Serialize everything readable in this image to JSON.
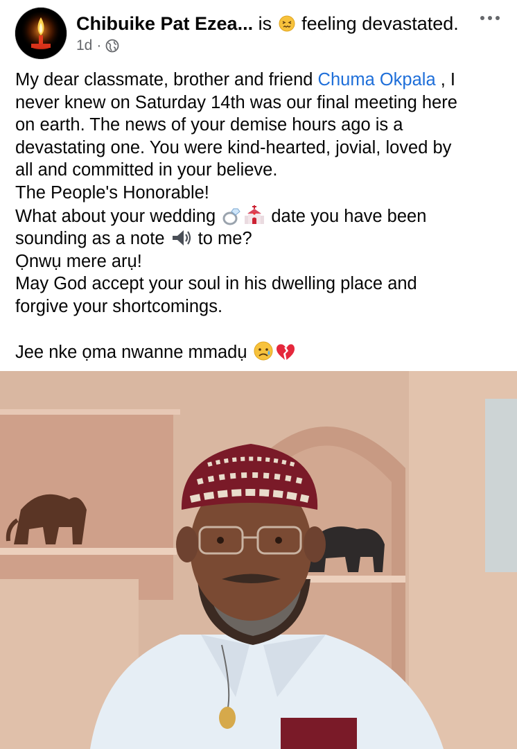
{
  "post": {
    "author": "Chibuike Pat Ezea...",
    "status_prefix": "is",
    "feeling_emoji": "confounded-face",
    "status_text": "feeling devastated.",
    "timestamp": "1d",
    "separator": "·",
    "audience_icon": "globe-icon",
    "more_icon": "more-options-icon",
    "body": {
      "l1_a": "My dear classmate, brother and friend ",
      "mention": "Chuma Okpala",
      "l1_b": " , I",
      "l2": "never knew on Saturday 14th was our final meeting here",
      "l3": "on earth. The news of your demise hours ago is a",
      "l4": "devastating one. You were kind-hearted, jovial, loved by",
      "l5": "all and committed in your believe.",
      "l6": "The People's Honorable!",
      "l7_a": "What about your wedding ",
      "l7_b": " date you have been",
      "l8_a": "sounding as a note ",
      "l8_b": " to me?",
      "l9": "Ọnwụ mere arụ!",
      "l10": "May God accept your soul in his dwelling place and",
      "l11": "forgive your shortcomings.",
      "l12": "Jee nke ọma nwanne mmadụ "
    },
    "inline_emojis": [
      "ring-emoji",
      "wedding-chapel-emoji",
      "speaker-emoji",
      "sad-relieved-face-emoji",
      "broken-heart-emoji"
    ],
    "photo": {
      "description_icon": "portrait-photo",
      "colors": {
        "wall": "#d9b7a1",
        "cap": "#7a1a28",
        "robe": "#e6eef5"
      }
    }
  },
  "colors": {
    "mention": "#1f6fd9",
    "meta": "#65676b",
    "text": "#050505"
  }
}
